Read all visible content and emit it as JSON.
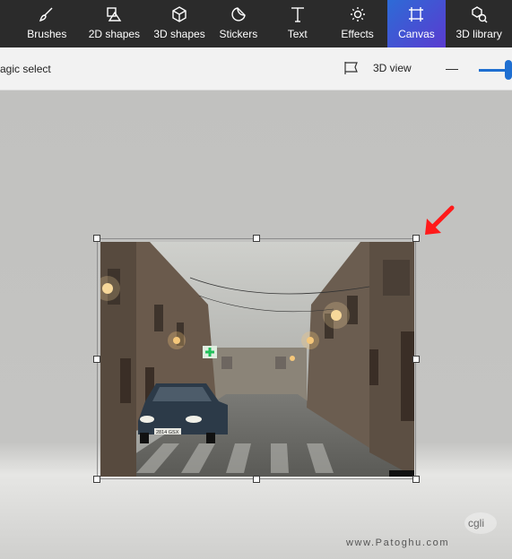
{
  "toolbar": {
    "tools": [
      {
        "label": "Brushes",
        "icon": "brush-icon"
      },
      {
        "label": "2D shapes",
        "icon": "2d-shapes-icon"
      },
      {
        "label": "3D shapes",
        "icon": "3d-shapes-icon"
      },
      {
        "label": "Stickers",
        "icon": "sticker-icon"
      },
      {
        "label": "Text",
        "icon": "text-icon"
      },
      {
        "label": "Effects",
        "icon": "effects-icon"
      },
      {
        "label": "Canvas",
        "icon": "canvas-icon",
        "active": true
      },
      {
        "label": "3D library",
        "icon": "3d-library-icon"
      }
    ],
    "active_color": "#3b5bd6"
  },
  "subbar": {
    "magic_select_label": "agic select",
    "view3d_label": "3D view",
    "zoom_slider_value": 1.0
  },
  "canvas": {
    "photo_icon": "rainy-street-photo",
    "plate_text": "2814 GSX",
    "annotation": "red-arrow-icon"
  },
  "watermark": {
    "logo_text": "cgli",
    "text": "www.Patoghu.com"
  }
}
